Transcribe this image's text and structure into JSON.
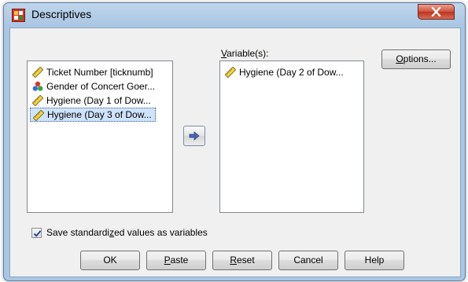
{
  "window": {
    "title": "Descriptives"
  },
  "source_list": {
    "items": [
      {
        "label": "Ticket Number [ticknumb]",
        "icon": "scale-ruler-icon",
        "selected": false
      },
      {
        "label": "Gender of Concert Goer...",
        "icon": "nominal-circles-icon",
        "selected": false
      },
      {
        "label": "Hygiene (Day 1 of Dow...",
        "icon": "scale-ruler-icon",
        "selected": false
      },
      {
        "label": "Hygiene (Day 3 of Dow...",
        "icon": "scale-ruler-icon",
        "selected": true
      }
    ]
  },
  "target_list": {
    "label_prefix": "",
    "label_mnemonic": "V",
    "label_rest": "ariable(s):",
    "items": [
      {
        "label": "Hygiene (Day 2 of Dow...",
        "icon": "scale-ruler-icon"
      }
    ]
  },
  "move_button": {
    "icon": "right-arrow-icon"
  },
  "options_button": {
    "mnemonic": "O",
    "rest": "ptions..."
  },
  "save_checkbox": {
    "checked": true,
    "label_before": "Save standardi",
    "mnemonic": "z",
    "label_after": "ed values as variables"
  },
  "buttons": {
    "ok": {
      "label": "OK"
    },
    "paste": {
      "mnemonic": "P",
      "rest": "aste"
    },
    "reset": {
      "mnemonic": "R",
      "rest": "eset"
    },
    "cancel": {
      "label": "Cancel"
    },
    "help": {
      "label": "Help"
    }
  },
  "colors": {
    "titlebar": "#a9c6e3",
    "close_button": "#c9432d",
    "selection": "#cfe3fb",
    "arrow": "#4a66b8"
  }
}
